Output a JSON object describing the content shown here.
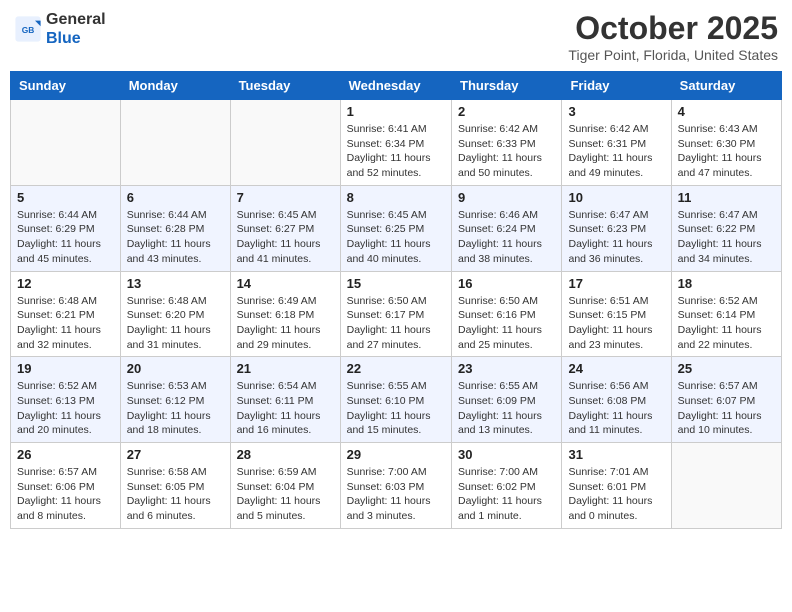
{
  "header": {
    "logo_line1": "General",
    "logo_line2": "Blue",
    "month": "October 2025",
    "location": "Tiger Point, Florida, United States"
  },
  "days_of_week": [
    "Sunday",
    "Monday",
    "Tuesday",
    "Wednesday",
    "Thursday",
    "Friday",
    "Saturday"
  ],
  "weeks": [
    [
      {
        "day": "",
        "info": ""
      },
      {
        "day": "",
        "info": ""
      },
      {
        "day": "",
        "info": ""
      },
      {
        "day": "1",
        "info": "Sunrise: 6:41 AM\nSunset: 6:34 PM\nDaylight: 11 hours\nand 52 minutes."
      },
      {
        "day": "2",
        "info": "Sunrise: 6:42 AM\nSunset: 6:33 PM\nDaylight: 11 hours\nand 50 minutes."
      },
      {
        "day": "3",
        "info": "Sunrise: 6:42 AM\nSunset: 6:31 PM\nDaylight: 11 hours\nand 49 minutes."
      },
      {
        "day": "4",
        "info": "Sunrise: 6:43 AM\nSunset: 6:30 PM\nDaylight: 11 hours\nand 47 minutes."
      }
    ],
    [
      {
        "day": "5",
        "info": "Sunrise: 6:44 AM\nSunset: 6:29 PM\nDaylight: 11 hours\nand 45 minutes."
      },
      {
        "day": "6",
        "info": "Sunrise: 6:44 AM\nSunset: 6:28 PM\nDaylight: 11 hours\nand 43 minutes."
      },
      {
        "day": "7",
        "info": "Sunrise: 6:45 AM\nSunset: 6:27 PM\nDaylight: 11 hours\nand 41 minutes."
      },
      {
        "day": "8",
        "info": "Sunrise: 6:45 AM\nSunset: 6:25 PM\nDaylight: 11 hours\nand 40 minutes."
      },
      {
        "day": "9",
        "info": "Sunrise: 6:46 AM\nSunset: 6:24 PM\nDaylight: 11 hours\nand 38 minutes."
      },
      {
        "day": "10",
        "info": "Sunrise: 6:47 AM\nSunset: 6:23 PM\nDaylight: 11 hours\nand 36 minutes."
      },
      {
        "day": "11",
        "info": "Sunrise: 6:47 AM\nSunset: 6:22 PM\nDaylight: 11 hours\nand 34 minutes."
      }
    ],
    [
      {
        "day": "12",
        "info": "Sunrise: 6:48 AM\nSunset: 6:21 PM\nDaylight: 11 hours\nand 32 minutes."
      },
      {
        "day": "13",
        "info": "Sunrise: 6:48 AM\nSunset: 6:20 PM\nDaylight: 11 hours\nand 31 minutes."
      },
      {
        "day": "14",
        "info": "Sunrise: 6:49 AM\nSunset: 6:18 PM\nDaylight: 11 hours\nand 29 minutes."
      },
      {
        "day": "15",
        "info": "Sunrise: 6:50 AM\nSunset: 6:17 PM\nDaylight: 11 hours\nand 27 minutes."
      },
      {
        "day": "16",
        "info": "Sunrise: 6:50 AM\nSunset: 6:16 PM\nDaylight: 11 hours\nand 25 minutes."
      },
      {
        "day": "17",
        "info": "Sunrise: 6:51 AM\nSunset: 6:15 PM\nDaylight: 11 hours\nand 23 minutes."
      },
      {
        "day": "18",
        "info": "Sunrise: 6:52 AM\nSunset: 6:14 PM\nDaylight: 11 hours\nand 22 minutes."
      }
    ],
    [
      {
        "day": "19",
        "info": "Sunrise: 6:52 AM\nSunset: 6:13 PM\nDaylight: 11 hours\nand 20 minutes."
      },
      {
        "day": "20",
        "info": "Sunrise: 6:53 AM\nSunset: 6:12 PM\nDaylight: 11 hours\nand 18 minutes."
      },
      {
        "day": "21",
        "info": "Sunrise: 6:54 AM\nSunset: 6:11 PM\nDaylight: 11 hours\nand 16 minutes."
      },
      {
        "day": "22",
        "info": "Sunrise: 6:55 AM\nSunset: 6:10 PM\nDaylight: 11 hours\nand 15 minutes."
      },
      {
        "day": "23",
        "info": "Sunrise: 6:55 AM\nSunset: 6:09 PM\nDaylight: 11 hours\nand 13 minutes."
      },
      {
        "day": "24",
        "info": "Sunrise: 6:56 AM\nSunset: 6:08 PM\nDaylight: 11 hours\nand 11 minutes."
      },
      {
        "day": "25",
        "info": "Sunrise: 6:57 AM\nSunset: 6:07 PM\nDaylight: 11 hours\nand 10 minutes."
      }
    ],
    [
      {
        "day": "26",
        "info": "Sunrise: 6:57 AM\nSunset: 6:06 PM\nDaylight: 11 hours\nand 8 minutes."
      },
      {
        "day": "27",
        "info": "Sunrise: 6:58 AM\nSunset: 6:05 PM\nDaylight: 11 hours\nand 6 minutes."
      },
      {
        "day": "28",
        "info": "Sunrise: 6:59 AM\nSunset: 6:04 PM\nDaylight: 11 hours\nand 5 minutes."
      },
      {
        "day": "29",
        "info": "Sunrise: 7:00 AM\nSunset: 6:03 PM\nDaylight: 11 hours\nand 3 minutes."
      },
      {
        "day": "30",
        "info": "Sunrise: 7:00 AM\nSunset: 6:02 PM\nDaylight: 11 hours\nand 1 minute."
      },
      {
        "day": "31",
        "info": "Sunrise: 7:01 AM\nSunset: 6:01 PM\nDaylight: 11 hours\nand 0 minutes."
      },
      {
        "day": "",
        "info": ""
      }
    ]
  ]
}
